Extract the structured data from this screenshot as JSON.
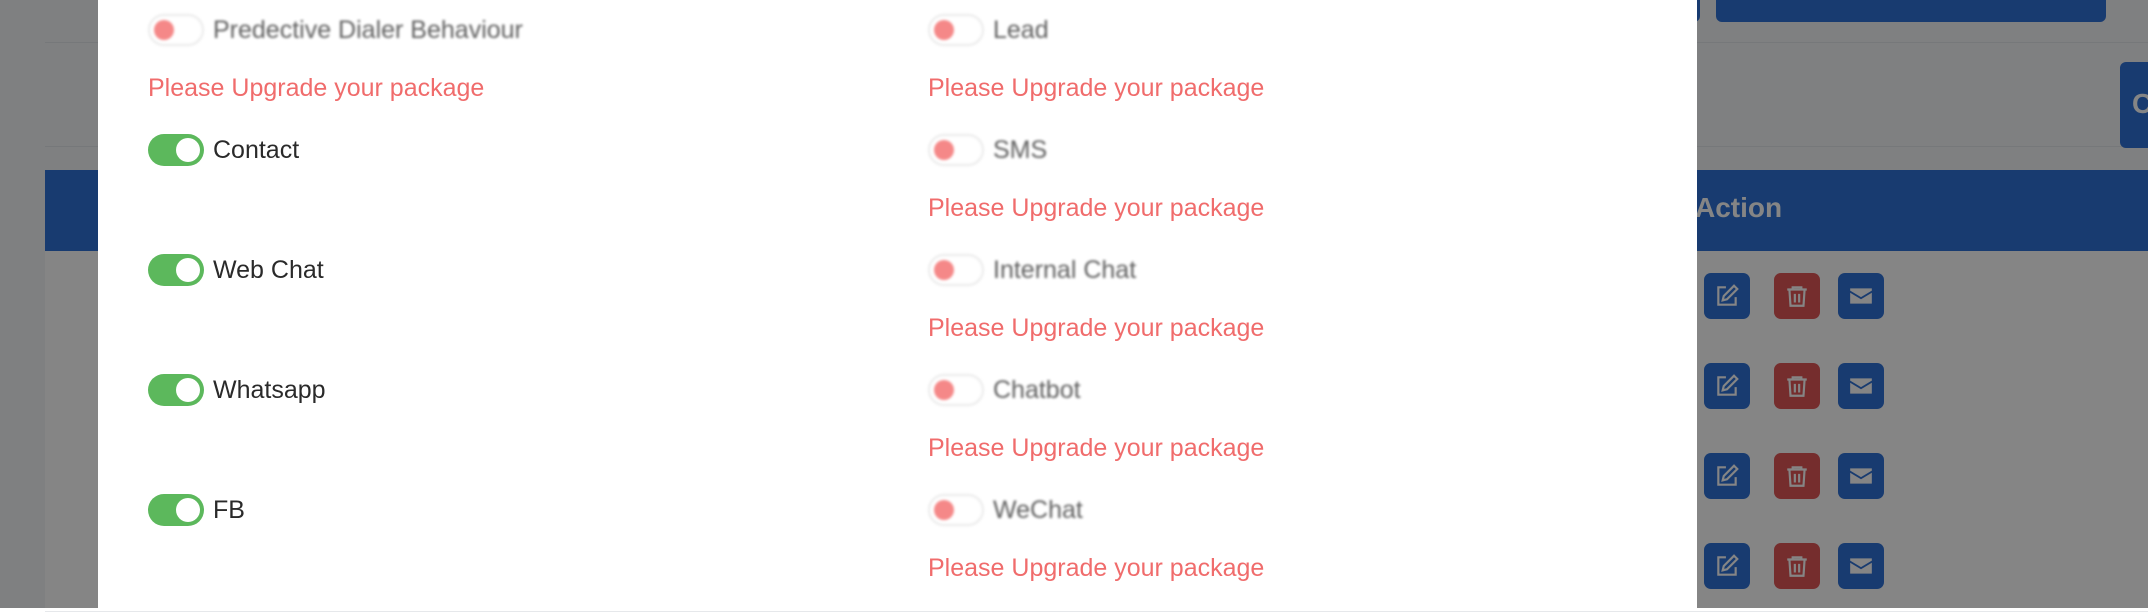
{
  "background": {
    "partial_tab_char": "C",
    "table_header_action": "Action",
    "row_count": 4
  },
  "modal": {
    "upgrade_message": "Please Upgrade your package",
    "left_column": [
      {
        "label": "Predective Dialer Behaviour",
        "enabled": false,
        "blurred": true,
        "upgrade": true
      },
      {
        "label": "Contact",
        "enabled": true,
        "blurred": false,
        "upgrade": false
      },
      {
        "label": "Web Chat",
        "enabled": true,
        "blurred": false,
        "upgrade": false
      },
      {
        "label": "Whatsapp",
        "enabled": true,
        "blurred": false,
        "upgrade": false
      },
      {
        "label": "FB",
        "enabled": true,
        "blurred": false,
        "upgrade": false
      }
    ],
    "right_column": [
      {
        "label": "Lead",
        "enabled": false,
        "blurred": true,
        "upgrade": true
      },
      {
        "label": "SMS",
        "enabled": false,
        "blurred": true,
        "upgrade": true
      },
      {
        "label": "Internal Chat",
        "enabled": false,
        "blurred": true,
        "upgrade": true
      },
      {
        "label": "Chatbot",
        "enabled": false,
        "blurred": true,
        "upgrade": true
      },
      {
        "label": "WeChat",
        "enabled": false,
        "blurred": true,
        "upgrade": true
      }
    ]
  },
  "colors": {
    "toggle_on": "#5cb85c",
    "toggle_off_knob": "#f26161",
    "upgrade_text": "#f06c6c",
    "primary": "#2f72d6",
    "danger": "#e15656"
  }
}
